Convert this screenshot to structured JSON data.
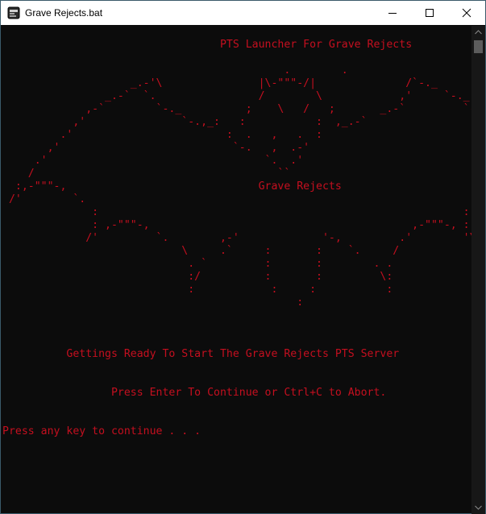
{
  "window": {
    "title": "Grave Rejects.bat"
  },
  "console": {
    "lines": [
      "                                  PTS Launcher For Grave Rejects",
      "",
      "                                            .        .",
      "                    _.-'\\               |\\-\"\"\"-/|              /`-._",
      "                _.-`  `.                /        \\            ,'     `-._",
      "             ,-`        `-._          ;    \\   /   ;       _.-`         `-.",
      "           ,'               `-.,_:   :           :  ,_.-`                 `.",
      "         .'                        :  .   ,   .  :                           `.",
      "       ,'                           `-.   ,  .-'                               `.",
      "     .'                                  `.  .'                                    \\",
      "    /                                      ``                                       \\",
      "  :,-\"\"\"-,                              Grave Rejects                         ,-\"\"\"-,;",
      " /'        `.                                                             .'        '\\",
      "              :                                                         :",
      "              : ,-\"\"\"-,                                         ,-\"\"\"-, :",
      "             /'         `.        ,-'             '-,         .'        '\\",
      "                            \\     .`     :       :    `.     /",
      "                             . `         :       :        . .",
      "                             :/          :       :         \\:",
      "                             :            :     :           :",
      "                                              :",
      "",
      "",
      "",
      "          Gettings Ready To Start The Grave Rejects PTS Server",
      "",
      "",
      "                 Press Enter To Continue or Ctrl+C to Abort.",
      "",
      "",
      "Press any key to continue . . ."
    ]
  },
  "colors": {
    "console_text": "#c50f1f",
    "console_bg": "#0c0c0c",
    "titlebar_bg": "#ffffff"
  },
  "icons": {
    "app": "batch-file-icon",
    "minimize": "minimize-icon",
    "maximize": "maximize-icon",
    "close": "close-icon",
    "scroll_up": "chevron-up-icon",
    "scroll_down": "chevron-down-icon"
  }
}
